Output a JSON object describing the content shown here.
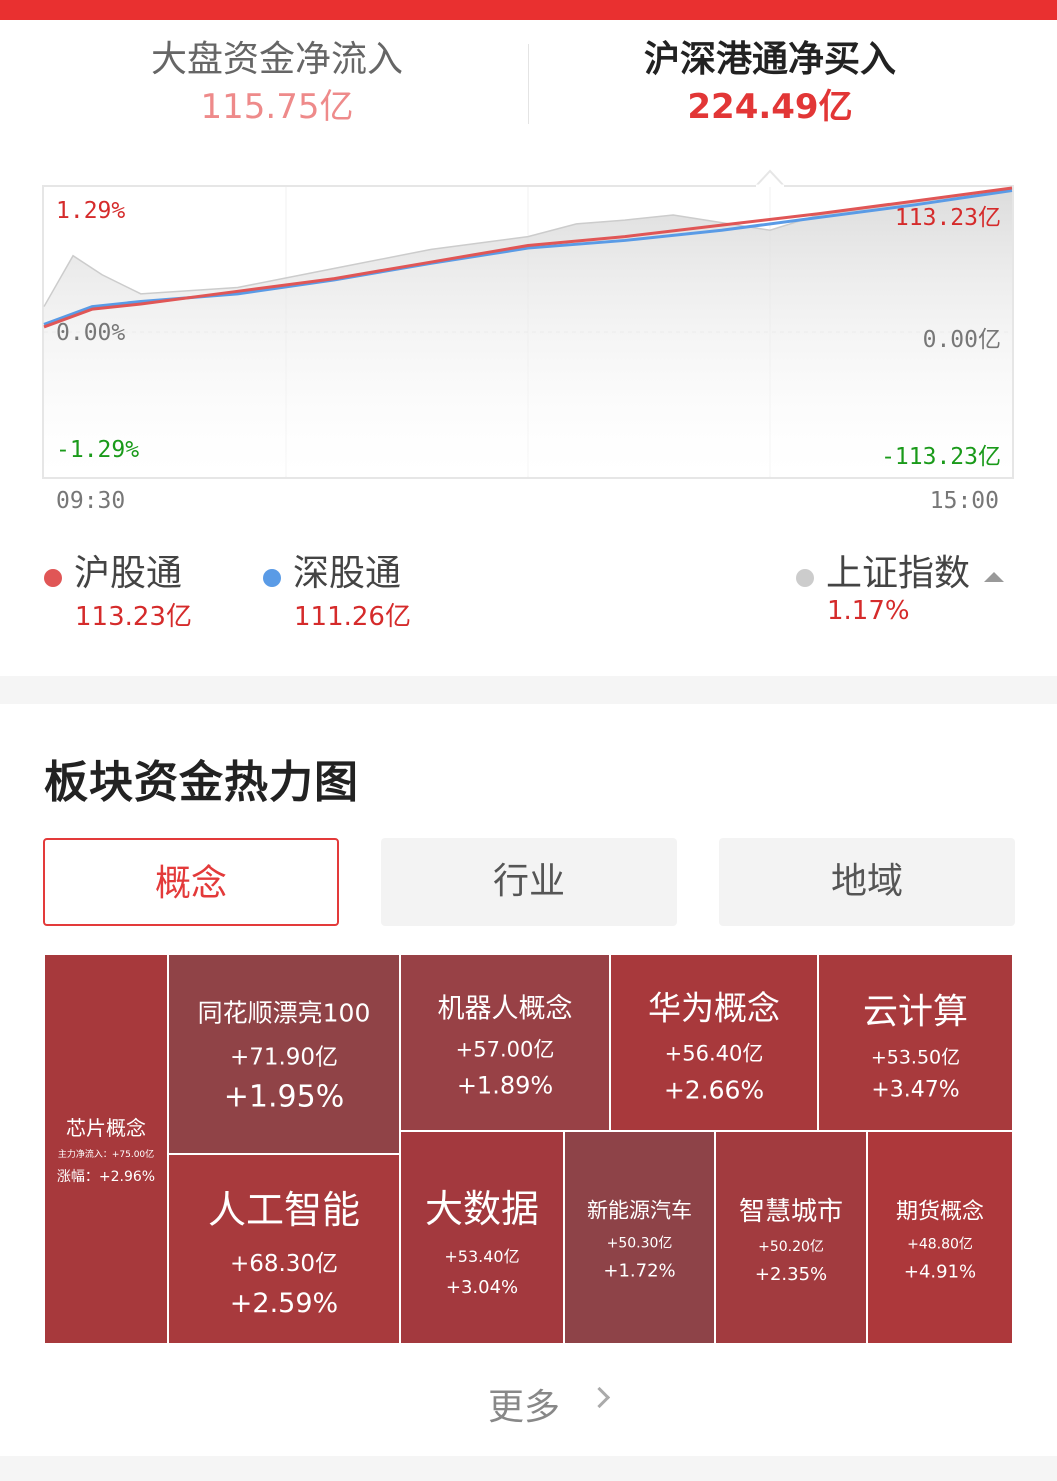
{
  "header": {
    "tab_left_title": "大盘资金净流入",
    "tab_left_value": "115.75亿",
    "tab_right_title": "沪深港通净买入",
    "tab_right_value": "224.49亿"
  },
  "chart_data": {
    "type": "line",
    "x_start": "09:30",
    "x_end": "15:00",
    "left_axis": {
      "top": "1.29%",
      "mid": "0.00%",
      "bottom": "-1.29%"
    },
    "right_axis": {
      "top": "113.23亿",
      "mid": "0.00亿",
      "bottom": "-113.23亿"
    },
    "ylim": [
      -113.23,
      113.23
    ],
    "colors": {
      "hgt": "#e05656",
      "sgt": "#5a9be6",
      "index": "#cccccc"
    },
    "series": [
      {
        "name": "沪股通",
        "x": [
          0,
          0.05,
          0.1,
          0.2,
          0.3,
          0.4,
          0.5,
          0.6,
          0.7,
          0.8,
          0.9,
          1.0
        ],
        "values": [
          4,
          18,
          22,
          32,
          42,
          55,
          68,
          75,
          84,
          93,
          103,
          113.23
        ]
      },
      {
        "name": "深股通",
        "x": [
          0,
          0.05,
          0.1,
          0.2,
          0.3,
          0.4,
          0.5,
          0.6,
          0.7,
          0.8,
          0.9,
          1.0
        ],
        "values": [
          6,
          20,
          24,
          30,
          41,
          54,
          66,
          72,
          80,
          90,
          100,
          111.26
        ]
      },
      {
        "name": "上证指数",
        "x": [
          0,
          0.03,
          0.06,
          0.1,
          0.2,
          0.3,
          0.4,
          0.5,
          0.55,
          0.6,
          0.65,
          0.7,
          0.75,
          0.8,
          0.9,
          1.0
        ],
        "values": [
          20,
          60,
          45,
          30,
          35,
          50,
          65,
          75,
          85,
          88,
          92,
          86,
          80,
          92,
          102,
          113
        ]
      }
    ]
  },
  "legend": [
    {
      "name": "沪股通",
      "value": "113.23亿",
      "color": "#e05656"
    },
    {
      "name": "深股通",
      "value": "111.26亿",
      "color": "#5a9be6"
    },
    {
      "name": "上证指数",
      "value": "1.17%",
      "color": "#cccccc"
    }
  ],
  "heatmap": {
    "title": "板块资金热力图",
    "tabs": [
      "概念",
      "行业",
      "地域"
    ],
    "tiles": [
      {
        "name": "芯片概念",
        "inflow_label": "主力净流入：",
        "inflow": "+75.00亿",
        "change_label": "涨幅：",
        "change": "+2.96%"
      },
      {
        "name": "同花顺漂亮100",
        "value": "+71.90亿",
        "pct": "+1.95%"
      },
      {
        "name": "机器人概念",
        "value": "+57.00亿",
        "pct": "+1.89%"
      },
      {
        "name": "华为概念",
        "value": "+56.40亿",
        "pct": "+2.66%"
      },
      {
        "name": "云计算",
        "value": "+53.50亿",
        "pct": "+3.47%"
      },
      {
        "name": "人工智能",
        "value": "+68.30亿",
        "pct": "+2.59%"
      },
      {
        "name": "大数据",
        "value": "+53.40亿",
        "pct": "+3.04%"
      },
      {
        "name": "新能源汽车",
        "value": "+50.30亿",
        "pct": "+1.72%"
      },
      {
        "name": "智慧城市",
        "value": "+50.20亿",
        "pct": "+2.35%"
      },
      {
        "name": "期货概念",
        "value": "+48.80亿",
        "pct": "+4.91%"
      }
    ],
    "more_label": "更多"
  }
}
